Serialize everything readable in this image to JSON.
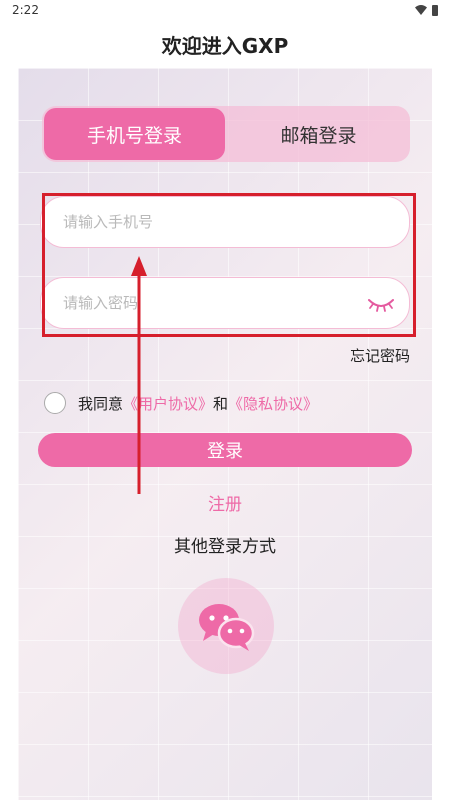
{
  "status_bar": {
    "time": "2:22",
    "icons": [
      "wifi-icon",
      "battery-icon"
    ]
  },
  "page": {
    "title": "欢迎进入GXP"
  },
  "tabs": [
    {
      "label": "手机号登录",
      "active": true
    },
    {
      "label": "邮箱登录",
      "active": false
    }
  ],
  "form": {
    "phone_placeholder": "请输入手机号",
    "phone_value": "",
    "password_placeholder": "请输入密码",
    "password_value": "",
    "password_toggle_icon": "eye-closed-icon",
    "forgot_password": "忘记密码"
  },
  "agreement": {
    "prefix": "我同意",
    "user_agreement": "《用户协议》",
    "conjunction": "和",
    "privacy_agreement": "《隐私协议》",
    "checked": false
  },
  "actions": {
    "login_label": "登录",
    "register_label": "注册",
    "other_methods_label": "其他登录方式",
    "wechat_icon": "wechat-icon"
  },
  "colors": {
    "accent": "#ee6aa7",
    "tab_track": "#f4bed7",
    "annotation": "#d61f2c"
  }
}
